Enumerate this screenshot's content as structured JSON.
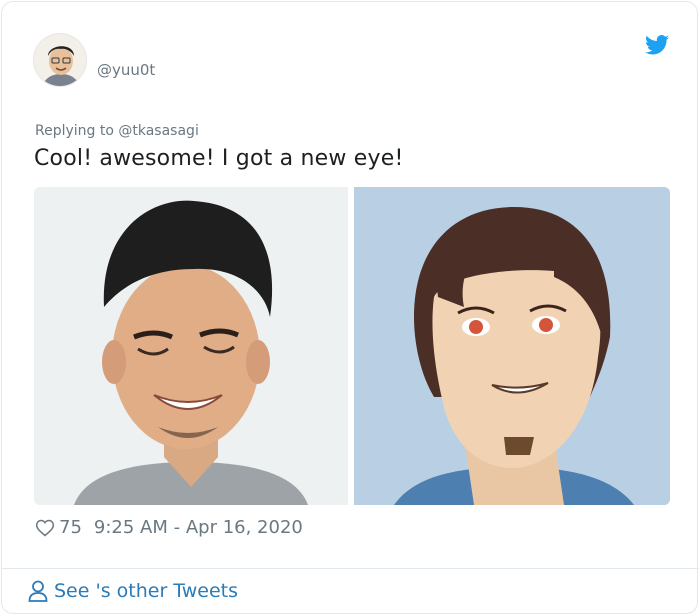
{
  "tweet": {
    "handle": "@yuu0t",
    "reply_to": "Replying to @tkasasagi",
    "text": "Cool! awesome! I got a new eye!",
    "likes": "75",
    "timestamp": "9:25 AM - Apr 16, 2020"
  },
  "footer": {
    "see_more": "See 's other Tweets"
  },
  "icons": {
    "brand": "twitter-bird-icon",
    "like": "heart-icon",
    "profile": "person-icon"
  },
  "colors": {
    "brand": "#1da1f2",
    "link": "#2b7bb9",
    "muted": "#697882",
    "border": "#e1e8ed"
  }
}
